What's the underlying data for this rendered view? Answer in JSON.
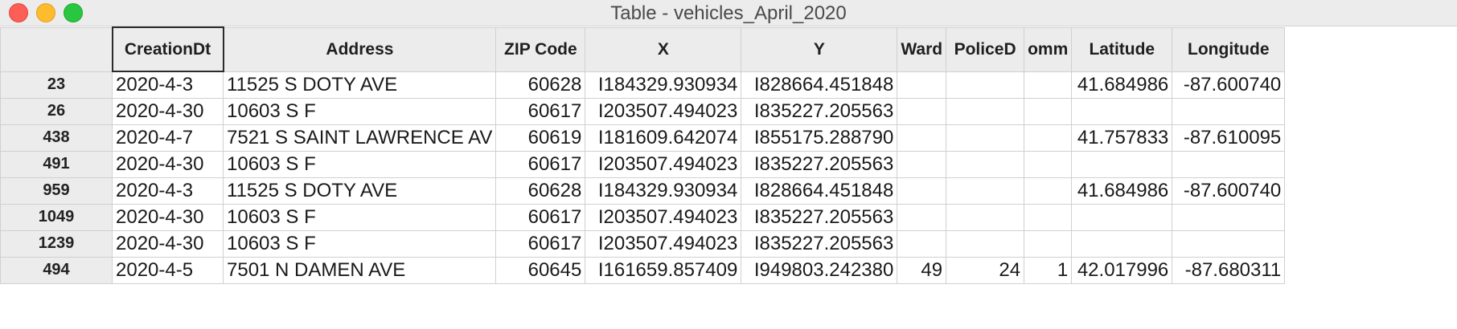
{
  "window": {
    "title": "Table - vehicles_April_2020"
  },
  "table": {
    "columns": [
      "",
      "CreationDt",
      "Address",
      "ZIP Code",
      "X",
      "Y",
      "Ward",
      "PoliceD",
      "omm",
      "Latitude",
      "Longitude"
    ],
    "rows": [
      {
        "id": "23",
        "cells": [
          "2020-4-3",
          "11525 S DOTY AVE",
          "60628",
          "I184329.930934",
          "I828664.451848",
          "",
          "",
          "",
          "41.684986",
          "-87.600740"
        ]
      },
      {
        "id": "26",
        "cells": [
          "2020-4-30",
          "10603 S F",
          "60617",
          "I203507.494023",
          "I835227.205563",
          "",
          "",
          "",
          "",
          ""
        ]
      },
      {
        "id": "438",
        "cells": [
          "2020-4-7",
          "7521 S SAINT LAWRENCE AV",
          "60619",
          "I181609.642074",
          "I855175.288790",
          "",
          "",
          "",
          "41.757833",
          "-87.610095"
        ]
      },
      {
        "id": "491",
        "cells": [
          "2020-4-30",
          "10603 S F",
          "60617",
          "I203507.494023",
          "I835227.205563",
          "",
          "",
          "",
          "",
          ""
        ]
      },
      {
        "id": "959",
        "cells": [
          "2020-4-3",
          "11525 S DOTY AVE",
          "60628",
          "I184329.930934",
          "I828664.451848",
          "",
          "",
          "",
          "41.684986",
          "-87.600740"
        ]
      },
      {
        "id": "1049",
        "cells": [
          "2020-4-30",
          "10603 S F",
          "60617",
          "I203507.494023",
          "I835227.205563",
          "",
          "",
          "",
          "",
          ""
        ]
      },
      {
        "id": "1239",
        "cells": [
          "2020-4-30",
          "10603 S F",
          "60617",
          "I203507.494023",
          "I835227.205563",
          "",
          "",
          "",
          "",
          ""
        ]
      },
      {
        "id": "494",
        "cells": [
          "2020-4-5",
          "7501 N DAMEN AVE",
          "60645",
          "I161659.857409",
          "I949803.242380",
          "49",
          "24",
          "1",
          "42.017996",
          "-87.680311"
        ]
      }
    ]
  }
}
